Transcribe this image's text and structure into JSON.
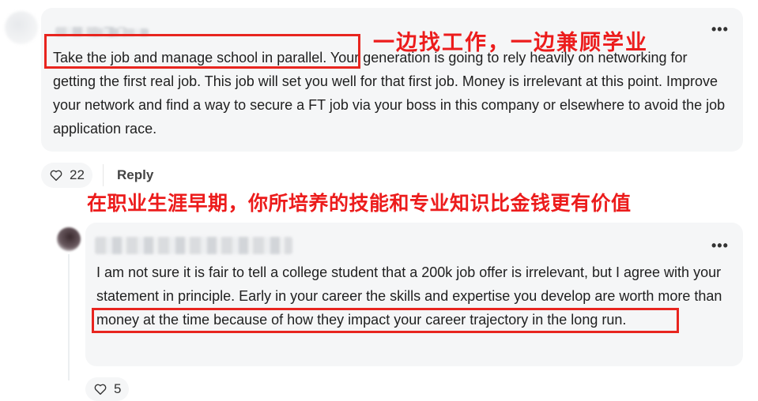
{
  "comment1": {
    "body_highlighted": "Take the job and manage school in parallel.",
    "body_rest": " Your generation is going to rely heavily on networking for getting the first real job. This job will set you well for that first job. Money is irrelevant at this point. Improve your network and find a way to secure a FT job via your boss in this company or elsewhere to avoid the job application race.",
    "more_label": "•••",
    "likes": "22",
    "reply_label": "Reply"
  },
  "comment2": {
    "body_before": "I am not sure it is fair to tell a college student that a 200k job offer is irrelevant, but I agree with your statement in principle. Early in your career the skills and expertise you develop ",
    "body_highlighted": "are worth more than money at the time because of how they impact your career",
    "body_after": " trajectory in the long run.",
    "more_label": "•••",
    "likes": "5"
  },
  "annotations": {
    "annotation_1": "一边找工作，一边兼顾学业",
    "annotation_2": "在职业生涯早期，你所培养的技能和专业知识比金钱更有价值"
  },
  "colors": {
    "card_bg": "#f5f6f7",
    "highlight_red": "#e8251f",
    "annotation_red": "#ec1c1c"
  },
  "icons": {
    "like": "heart-outline-icon",
    "more": "more-horizontal-icon"
  }
}
